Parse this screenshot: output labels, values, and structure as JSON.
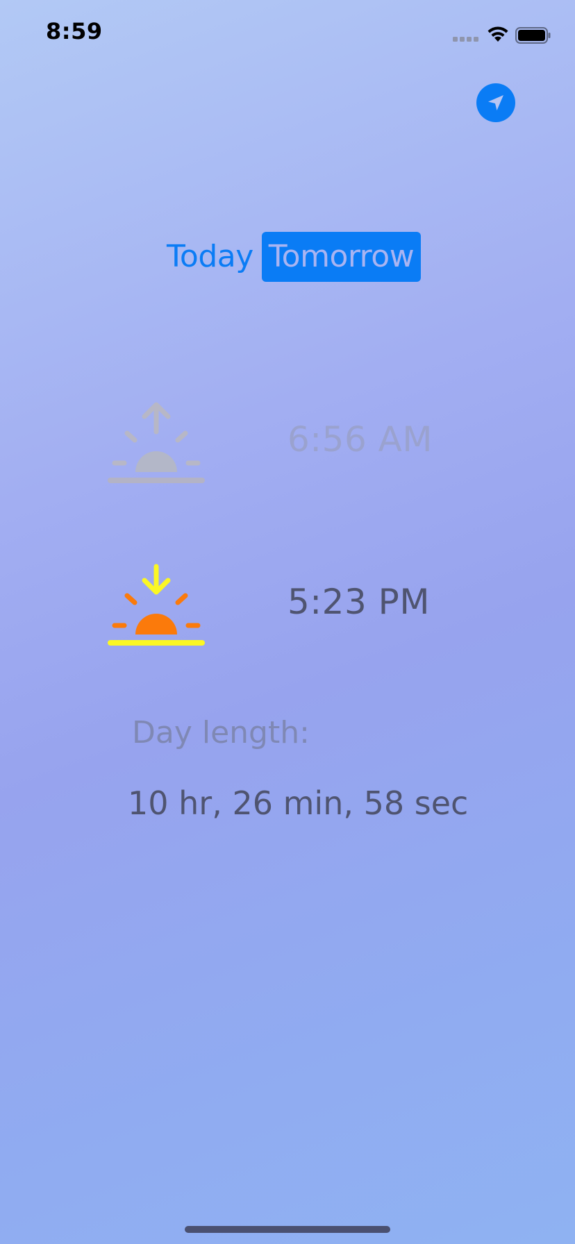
{
  "status_bar": {
    "time": "8:59",
    "icons": [
      "cellular-signal-icon",
      "wifi-icon",
      "battery-icon"
    ]
  },
  "location_button": {
    "icon": "location-arrow-icon",
    "color": "#0a7cf5"
  },
  "day_selector": {
    "today_label": "Today",
    "tomorrow_label": "Tomorrow",
    "selected": "Tomorrow",
    "accent_color": "#0a7cf5"
  },
  "sunrise": {
    "icon": "sunrise-icon",
    "time": "6:56 AM",
    "active": false
  },
  "sunset": {
    "icon": "sunset-icon",
    "time": "5:23 PM",
    "active": true
  },
  "day_length": {
    "label": "Day length:",
    "value": "10 hr, 26 min, 58 sec"
  },
  "colors": {
    "sun_orange": "#fb7a0b",
    "sun_yellow": "#fbf724",
    "inactive_grey": "#b3b7c8"
  }
}
